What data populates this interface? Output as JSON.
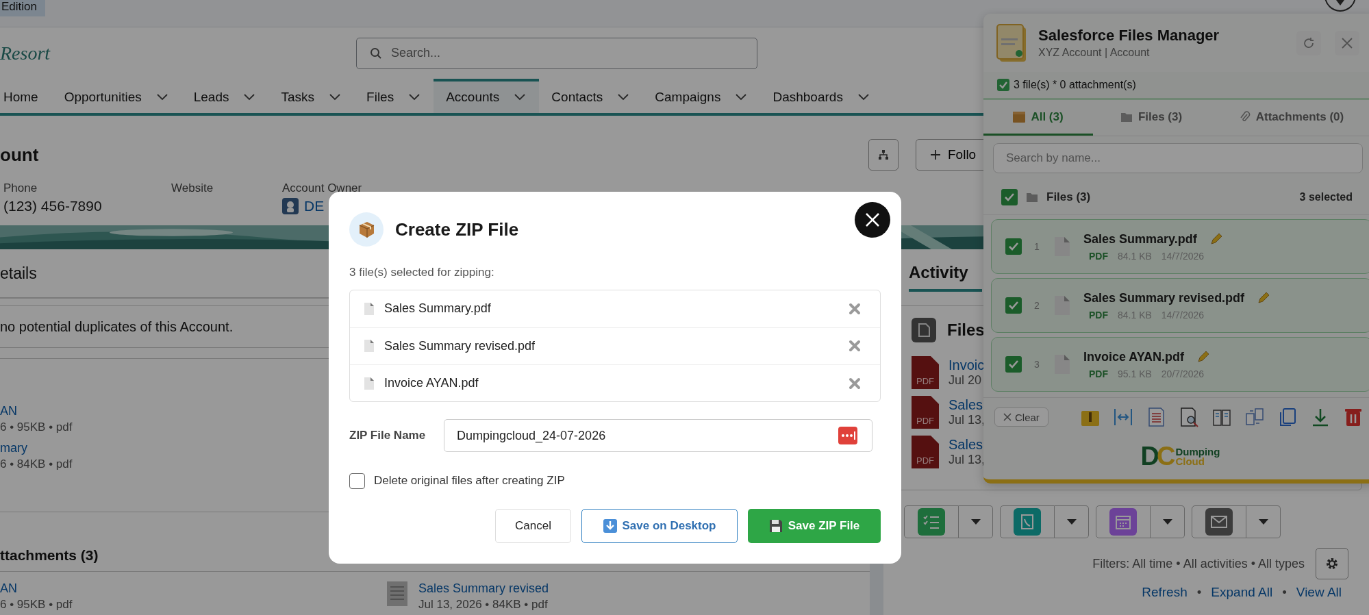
{
  "top_bar": {
    "edition": "Edition"
  },
  "header": {
    "logo": "Resort",
    "search_placeholder": "Search..."
  },
  "nav": [
    {
      "label": "Home",
      "selected": false,
      "dropdown": false
    },
    {
      "label": "Opportunities",
      "selected": false,
      "dropdown": true
    },
    {
      "label": "Leads",
      "selected": false,
      "dropdown": true
    },
    {
      "label": "Tasks",
      "selected": false,
      "dropdown": true
    },
    {
      "label": "Files",
      "selected": false,
      "dropdown": true
    },
    {
      "label": "Accounts",
      "selected": true,
      "dropdown": true
    },
    {
      "label": "Contacts",
      "selected": false,
      "dropdown": true
    },
    {
      "label": "Campaigns",
      "selected": false,
      "dropdown": true
    },
    {
      "label": "Dashboards",
      "selected": false,
      "dropdown": true
    }
  ],
  "record": {
    "title": "ount",
    "follow": "Follo",
    "fields": [
      {
        "label": "Phone",
        "value": "(123) 456-7890",
        "kind": "text"
      },
      {
        "label": "Website"
      },
      {
        "label": "Account Owner",
        "value": "DE",
        "kind": "user"
      }
    ]
  },
  "details_tab": "etails",
  "duplicates": "no potential duplicates of this Account.",
  "related_files": [
    {
      "name": "AN",
      "meta": "6 • 95KB • pdf"
    },
    {
      "name": "mary",
      "meta": "6 • 84KB • pdf"
    }
  ],
  "attachments": {
    "title": "ttachments (3)",
    "items": [
      {
        "name": "AN",
        "meta": "6 • 95KB • pdf",
        "icon": false
      },
      {
        "name": "Sales Summary revised",
        "meta": "Jul 13, 2026 • 84KB • pdf",
        "icon": true
      }
    ]
  },
  "activity": {
    "tab": "Activity",
    "files_title": "Files",
    "files": [
      {
        "badge": "PDF",
        "name": "Invoic",
        "date": "Jul 20"
      },
      {
        "badge": "PDF",
        "name": "Sales",
        "date": "Jul 13,"
      },
      {
        "badge": "PDF",
        "name": "Sales",
        "date": "Jul 13,"
      }
    ],
    "actions": [
      {
        "kind": "task",
        "color": "#1e6e3c"
      },
      {
        "kind": "call",
        "color": "#0c6a66"
      },
      {
        "kind": "event",
        "color": "#6c4298"
      },
      {
        "kind": "email",
        "color": "#3c3c3c"
      }
    ],
    "filters": "Filters: All time • All activities • All types",
    "links": [
      "Refresh",
      "Expand All",
      "View All"
    ],
    "separator": "•"
  },
  "files_panel": {
    "title": "Salesforce Files Manager",
    "subtitle": "XYZ Account | Account",
    "summary": "3 file(s) * 0 attachment(s)",
    "tabs": [
      {
        "label": "All (3)",
        "selected": true,
        "kind": "all"
      },
      {
        "label": "Files (3)",
        "selected": false,
        "kind": "files"
      },
      {
        "label": "Attachments (0)",
        "selected": false,
        "kind": "attachments"
      }
    ],
    "search_placeholder": "Search by name...",
    "group": {
      "label": "Files (3)",
      "checked": true,
      "count": "3 selected"
    },
    "files": [
      {
        "index": "1",
        "name": "Sales Summary.pdf",
        "type": "PDF",
        "size": "84.1 KB",
        "date": "14/7/2026",
        "checked": true
      },
      {
        "index": "2",
        "name": "Sales Summary revised.pdf",
        "type": "PDF",
        "size": "84.1 KB",
        "date": "14/7/2026",
        "checked": true
      },
      {
        "index": "3",
        "name": "Invoice AYAN.pdf",
        "type": "PDF",
        "size": "95.1 KB",
        "date": "20/7/2026",
        "checked": true
      }
    ],
    "clear": "Clear",
    "brand": {
      "mark": [
        "D",
        "C"
      ],
      "line1": "Dumping",
      "line2": "Cloud"
    }
  },
  "modal": {
    "title": "Create ZIP File",
    "count": "3 file(s) selected for zipping:",
    "files": [
      "Sales Summary.pdf",
      "Sales Summary revised.pdf",
      "Invoice AYAN.pdf"
    ],
    "name_label": "ZIP File Name",
    "name_value": "Dumpingcloud_24-07-2026",
    "delete_option": {
      "label": "Delete original files after creating ZIP",
      "checked": false
    },
    "buttons": [
      {
        "label": "Cancel",
        "kind": "cancel"
      },
      {
        "label": "Save on Desktop",
        "kind": "desktop"
      },
      {
        "label": "Save ZIP File",
        "kind": "save"
      }
    ]
  }
}
